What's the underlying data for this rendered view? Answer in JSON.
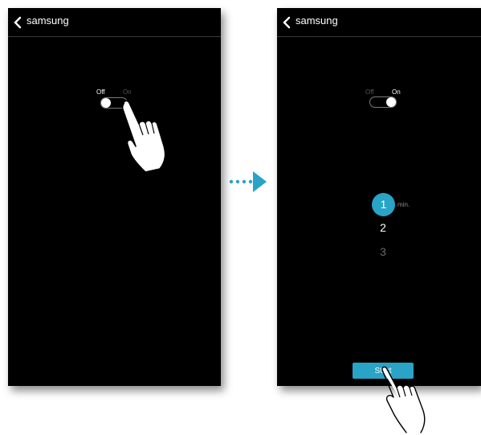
{
  "colors": {
    "screen_background": "#000000",
    "accent": "#29a3c6",
    "text_primary": "#ffffff",
    "text_dim": "#555555"
  },
  "left_screen": {
    "header": {
      "title": "samsung",
      "back_icon": "chevron-left-icon"
    },
    "timer_switch": {
      "off_label": "Off",
      "on_label": "On",
      "state": "off"
    },
    "gesture_icon": "pointing-hand-icon"
  },
  "transition_arrow_icon": "dotted-arrow-right-icon",
  "right_screen": {
    "header": {
      "title": "samsung",
      "back_icon": "chevron-left-icon"
    },
    "timer_switch": {
      "off_label": "Off",
      "on_label": "On",
      "state": "on"
    },
    "minute_picker": {
      "options": [
        "1",
        "2",
        "3"
      ],
      "selected": "1",
      "unit": "min."
    },
    "start_button": {
      "label": "Start"
    },
    "gesture_icon": "pointing-hand-icon"
  }
}
